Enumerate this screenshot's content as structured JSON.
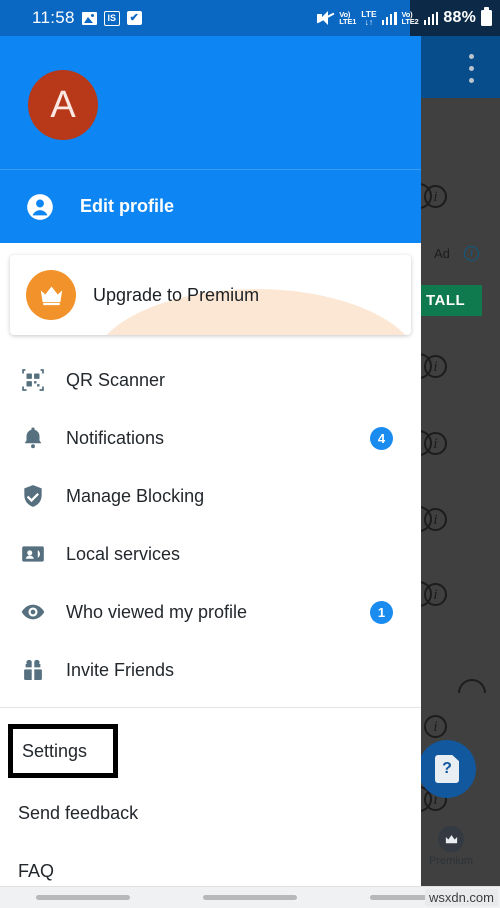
{
  "statusbar": {
    "time": "11:58",
    "icons": [
      "photo-icon",
      "is-badge-icon",
      "check-icon",
      "mute-icon"
    ],
    "sim1_volte": "Vo)",
    "sim1_label": "LTE1",
    "lte_top": "LTE",
    "lte_arrows": "↓↑",
    "sim2_volte": "Vo)",
    "sim2_label": "LTE2",
    "battery_percent": "88%"
  },
  "drawer": {
    "avatar_letter": "A",
    "edit_profile_label": "Edit profile",
    "premium_card": {
      "label": "Upgrade to Premium",
      "icon": "crown-icon",
      "icon_color": "#f2922a"
    },
    "menu_items": [
      {
        "label": "QR Scanner",
        "icon": "qr-code-icon",
        "badge": ""
      },
      {
        "label": "Notifications",
        "icon": "bell-icon",
        "badge": "4"
      },
      {
        "label": "Manage Blocking",
        "icon": "shield-check-icon",
        "badge": ""
      },
      {
        "label": "Local services",
        "icon": "contact-card-icon",
        "badge": ""
      },
      {
        "label": "Who viewed my profile",
        "icon": "eye-icon",
        "badge": "1"
      },
      {
        "label": "Invite Friends",
        "icon": "gift-icon",
        "badge": ""
      }
    ],
    "footer_items": [
      {
        "label": "Settings",
        "highlighted": true
      },
      {
        "label": "Send feedback",
        "highlighted": false
      },
      {
        "label": "FAQ",
        "highlighted": false
      }
    ]
  },
  "background": {
    "ad_label": "Ad",
    "install_button": "TALL",
    "fab_icon": "help-card-icon",
    "bottom_nav_premium_label": "Premium",
    "overflow_menu": "kebab-menu-icon"
  },
  "watermark": "wsxdn.com",
  "colors": {
    "header_blue": "#0d85f2",
    "statusbar_blue": "#0a67c2",
    "avatar_red": "#b8391a",
    "premium_orange": "#f2922a",
    "badge_blue": "#1a8cf0",
    "install_green": "#0f7a4d",
    "fab_blue": "#11589e"
  }
}
